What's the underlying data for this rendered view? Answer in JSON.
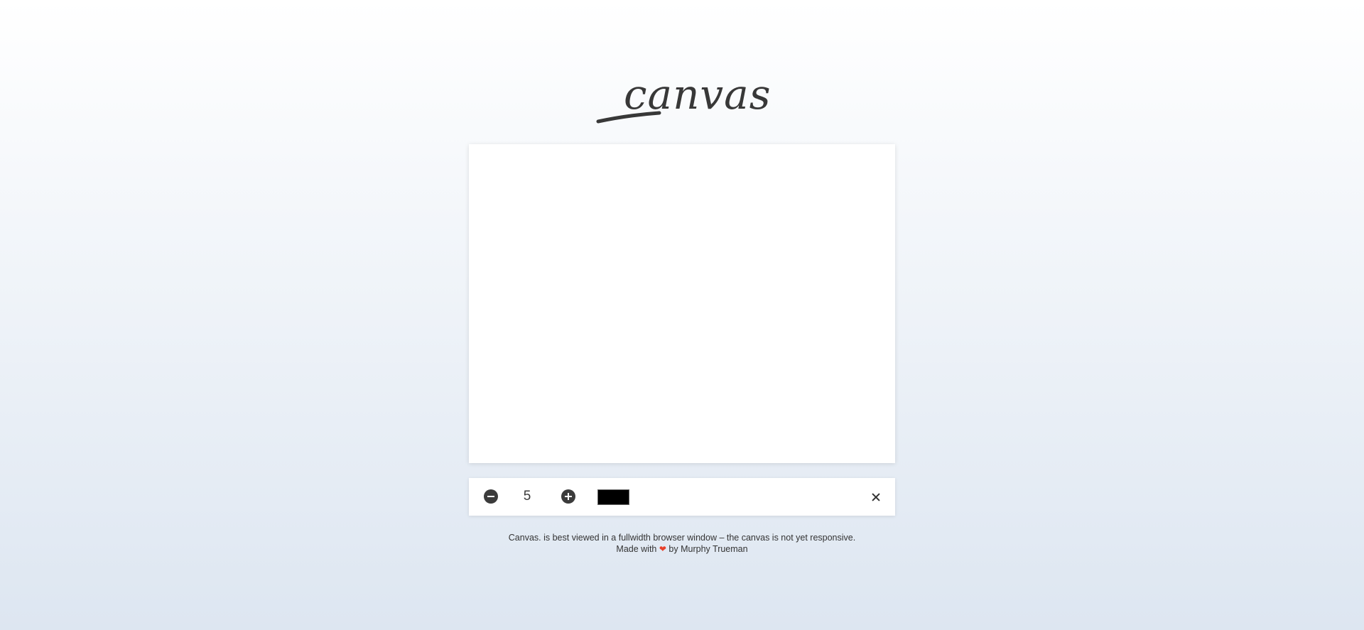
{
  "logo": {
    "text": "canvas."
  },
  "toolbar": {
    "decrease_icon": "minus-circle-icon",
    "brush_size": "5",
    "increase_icon": "plus-circle-icon",
    "color": "#000000",
    "clear_icon": "close-icon"
  },
  "footer": {
    "line1": "Canvas. is best viewed in a fullwidth browser window – the canvas is not yet responsive.",
    "line2_prefix": "Made with",
    "heart": "❤",
    "line2_suffix": "by Murphy Trueman"
  },
  "colors": {
    "background_top": "#ffffff",
    "background_bottom": "#dde6f1",
    "heart": "#e8412b",
    "logo": "#383838"
  }
}
